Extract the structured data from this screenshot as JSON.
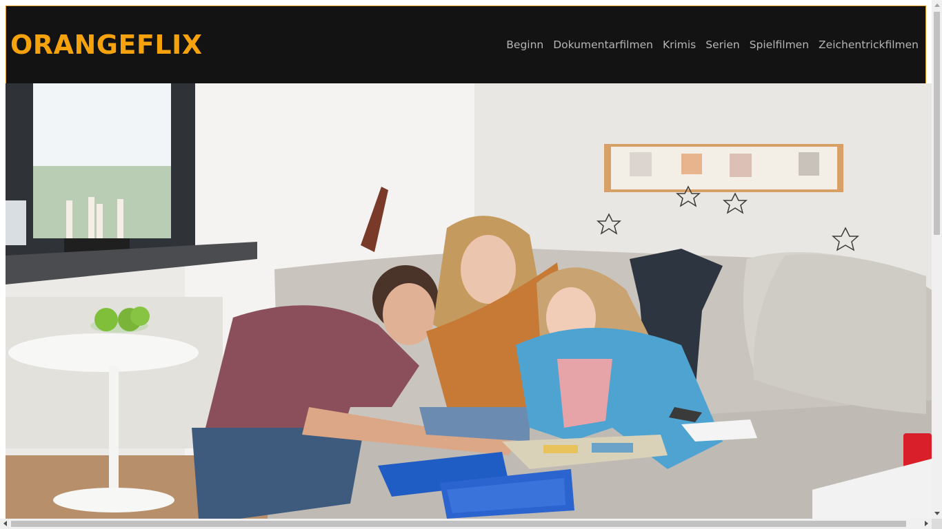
{
  "header": {
    "brand": "ORANGEFLIX",
    "nav": [
      {
        "label": "Beginn"
      },
      {
        "label": "Dokumentarfilmen"
      },
      {
        "label": "Krimis"
      },
      {
        "label": "Serien"
      },
      {
        "label": "Spielfilmen"
      },
      {
        "label": "Zeichentrickfilmen"
      }
    ]
  },
  "colors": {
    "brand": "#f6a20c",
    "header_bg": "#131313",
    "header_border": "#e39b1f",
    "nav_text": "#b6b6b6"
  },
  "hero": {
    "icon": "family-living-room-photo"
  }
}
